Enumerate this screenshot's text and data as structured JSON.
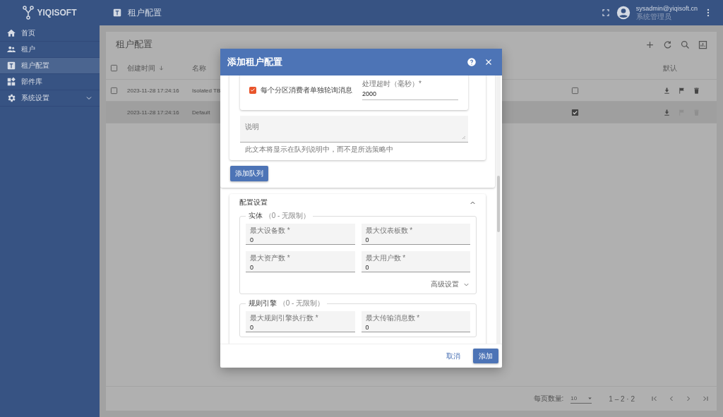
{
  "app": {
    "logo": "YIQISOFT",
    "page_title": "租户配置"
  },
  "header": {
    "user_email": "sysadmin@yiqisoft.cn",
    "user_role": "系统管理员"
  },
  "sidebar": {
    "items": [
      {
        "label": "首页",
        "selected": false
      },
      {
        "label": "租户",
        "selected": false
      },
      {
        "label": "租户配置",
        "selected": true
      },
      {
        "label": "部件库",
        "selected": false
      },
      {
        "label": "系统设置",
        "selected": false,
        "expanded": false
      }
    ]
  },
  "table": {
    "title": "租户配置",
    "select_all_checked": false,
    "columns": [
      {
        "label": "创建时间",
        "sorted": true
      },
      {
        "label": "名称",
        "sorted": false
      },
      {
        "label": "默认",
        "sorted": false
      }
    ],
    "rows": [
      {
        "created": "2023-11-28 17:24:16",
        "name": "Isolated TB",
        "selectable": true,
        "selected": false,
        "default": false,
        "actions_disabled": false
      },
      {
        "created": "2023-11-28 17:24:16",
        "name": "Default",
        "selectable": false,
        "selected": true,
        "default": true,
        "actions_disabled": true
      }
    ]
  },
  "pagination": {
    "page_size_label": "每页数量:",
    "page_size": "10",
    "range": "1 – 2 · 2"
  },
  "dialog": {
    "title": "添加租户配置",
    "queue": {
      "poll_checkbox": {
        "label": "每个分区消费者单独轮询消息",
        "checked": true
      },
      "timeout_field": {
        "label": "处理超时（毫秒）*",
        "value": "2000"
      },
      "description": {
        "placeholder": "说明",
        "hint": "此文本将显示在队列说明中，而不是所选策略中"
      },
      "add_queue_button": "添加队列"
    },
    "config": {
      "title": "配置设置",
      "expanded": true,
      "groups": [
        {
          "legend": "实体",
          "note": "（0 - 无限制）",
          "fields": [
            {
              "label": "最大设备数 *",
              "value": "0"
            },
            {
              "label": "最大仪表板数 *",
              "value": "0"
            },
            {
              "label": "最大资产数 *",
              "value": "0"
            },
            {
              "label": "最大用户数 *",
              "value": "0"
            }
          ],
          "advanced": "高级设置"
        },
        {
          "legend": "规则引擎",
          "note": "（0 - 无限制）",
          "fields": [
            {
              "label": "最大规则引擎执行数 *",
              "value": "0"
            },
            {
              "label": "最大传输消息数 *",
              "value": "0"
            }
          ]
        }
      ]
    },
    "buttons": {
      "cancel": "取消",
      "submit": "添加"
    }
  }
}
